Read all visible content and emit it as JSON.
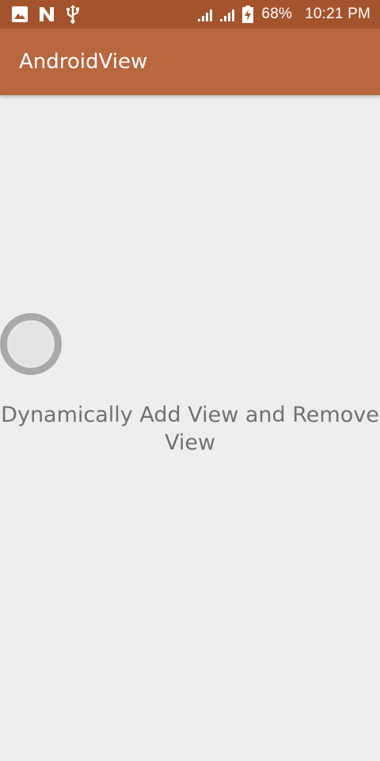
{
  "status_bar": {
    "battery_percent": "68%",
    "time": "10:21 PM",
    "left_icons": [
      "image-icon",
      "n-notification-icon",
      "usb-icon"
    ],
    "right_icons": [
      "signal-1-icon",
      "signal-2-icon",
      "battery-charging-icon"
    ]
  },
  "app_bar": {
    "title": "AndroidView",
    "color": "#b8673f"
  },
  "main": {
    "text": "Dynamically Add View and Remove View"
  },
  "colors": {
    "status_bar": "#a3542d",
    "app_bar": "#b8673f",
    "background": "#eeeeee",
    "text": "#707275",
    "radio_ring": "#a9a9a9"
  }
}
